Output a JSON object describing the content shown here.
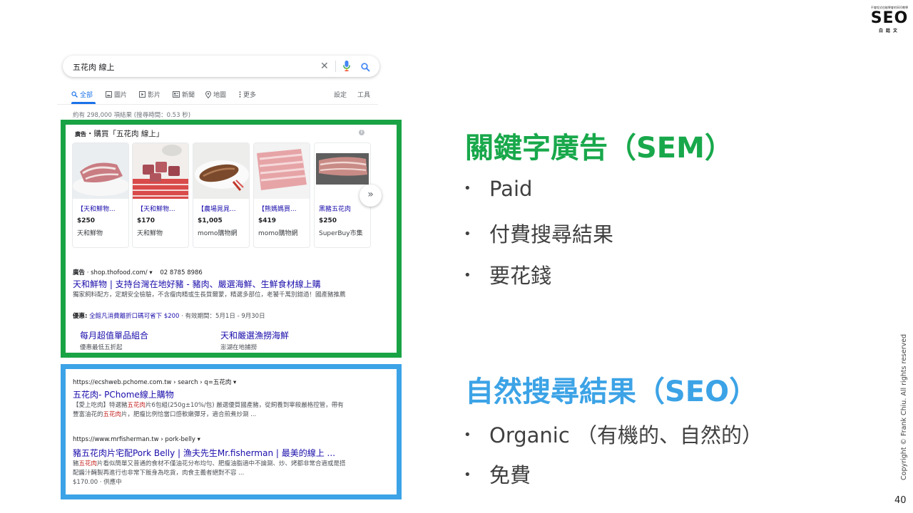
{
  "logo": {
    "tagline": "不會程式也能學會的SEO教學",
    "main": "SEO",
    "sub": "白話文"
  },
  "search": {
    "query": "五花肉 線上",
    "clear_symbol": "✕",
    "tabs": [
      {
        "label": "全部",
        "icon": "search-icon"
      },
      {
        "label": "圖片",
        "icon": "image-icon"
      },
      {
        "label": "影片",
        "icon": "video-icon"
      },
      {
        "label": "新聞",
        "icon": "news-icon"
      },
      {
        "label": "地圖",
        "icon": "map-pin-icon"
      },
      {
        "label": "更多",
        "icon": "more-vertical-icon"
      }
    ],
    "settings": "設定",
    "tools": "工具",
    "result_stats": "約有 298,000 項結果 (搜尋時間：0.53 秒)"
  },
  "shopping": {
    "ad_tag": "廣告",
    "heading": "・購買「五花肉 線上」",
    "info": "i",
    "next": "»",
    "products": [
      {
        "title": "【天和鮮物...",
        "price": "$250",
        "store": "天和鮮物"
      },
      {
        "title": "【天和鮮物...",
        "price": "$170",
        "store": "天和鮮物"
      },
      {
        "title": "【農場晁晁...",
        "price": "$1,005",
        "store": "momo購物網"
      },
      {
        "title": "【熊媽媽買...",
        "price": "$419",
        "store": "momo購物網"
      },
      {
        "title": "黑豬五花肉",
        "price": "$250",
        "store": "SuperBuy市集"
      }
    ]
  },
  "text_ad": {
    "ad_tag": "廣告",
    "url": "· shop.thofood.com/ ▾",
    "phone": "02 8785 8986",
    "title": "天和鮮物 | 支持台灣在地好豬 - 豬肉、嚴選海鮮、生鮮食材線上購",
    "description": "獨家飼料配方，定期安全檢驗，不含瘦肉精或生長質爾蒙，精選多部位，老饕千萬別錯過！國產豬推薦",
    "promo_label": "優惠:",
    "promo_link": "全館凡消費離折口碼可省下 $200",
    "promo_period": "· 有效期間：5月1日 - 9月30日",
    "sitelinks": [
      {
        "title": "每月超值單品組合",
        "desc": "優惠最低五折起"
      },
      {
        "title": "天和嚴選漁撈海鮮",
        "desc": "澎湖在地捕撈"
      }
    ]
  },
  "organic": {
    "results": [
      {
        "url": "https://ecshweb.pchome.com.tw › search › q=五花肉 ▾",
        "title": "五花肉- PChome線上購物",
        "desc_before": "【愛上吃肉】特選豬",
        "desc_hl1": "五花肉",
        "desc_mid": "片6包組(250g±10%/包) 嚴選優質國產豬，從飼養到宰殺嚴格控管，帶有豐富油花的",
        "desc_hl2": "五花肉",
        "desc_after": "片，肥瘦比例恰當口感軟嫩彈牙，適合煎煮炒涮 ..."
      },
      {
        "url": "https://www.mrfisherman.tw › pork-belly ▾",
        "title": "豬五花肉片宅配Pork Belly | 漁夫先生Mr.fisherman | 最美的線上 ...",
        "desc_before": "豬",
        "desc_hl1": "五花肉",
        "desc_mid": "片看似簡單又普通的食材不僅油花分布均勻、肥瘦油脂適中不論涮、炒、烤都非常合適或是搭配醬汁醃製再進行也非常下飯身為吃貨，肉食主義者絕對不容 ...",
        "desc_hl2": "",
        "desc_after": "",
        "extra": "$170.00 · 供應中"
      }
    ]
  },
  "sem": {
    "heading": "關鍵字廣告（SEM）",
    "bullets": [
      "Paid",
      "付費搜尋結果",
      "要花錢"
    ]
  },
  "seo": {
    "heading": "自然搜尋結果（SEO）",
    "bullets": [
      "Organic （有機的、自然的）",
      "免費"
    ]
  },
  "footer": {
    "copyright": "Copyright © Frank Chiu. All rights reserved",
    "page_number": "40"
  },
  "colors": {
    "sem_green": "#18a84b",
    "seo_blue": "#3ca3e6",
    "link_blue": "#1a0dab",
    "tab_blue": "#1a73e8"
  }
}
